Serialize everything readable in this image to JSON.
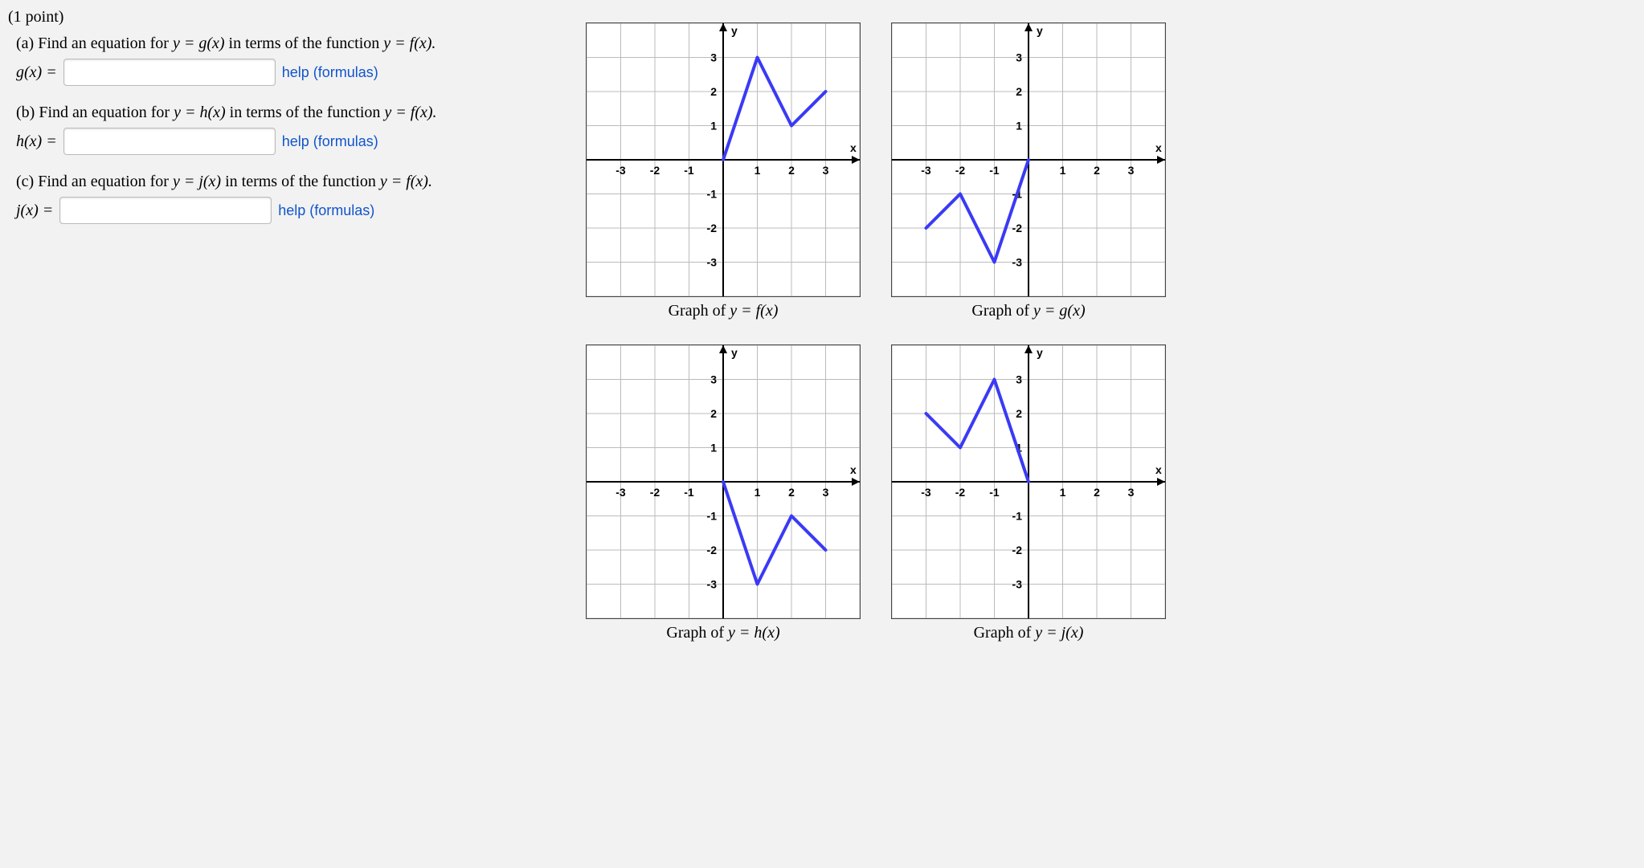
{
  "points_label": "(1 point)",
  "parts": {
    "a": {
      "prompt_prefix": "(a) Find an equation for ",
      "fn_lhs": "y = g(x)",
      "prompt_mid": " in terms of the function ",
      "fn_rhs": "y = f(x).",
      "answer_label": "g(x) =",
      "help_label": "help (formulas)"
    },
    "b": {
      "prompt_prefix": "(b) Find an equation for ",
      "fn_lhs": "y = h(x)",
      "prompt_mid": " in terms of the function ",
      "fn_rhs": "y = f(x).",
      "answer_label": "h(x) =",
      "help_label": "help (formulas)"
    },
    "c": {
      "prompt_prefix": "(c) Find an equation for ",
      "fn_lhs": "y = j(x)",
      "prompt_mid": " in terms of the function ",
      "fn_rhs": "y = f(x).",
      "answer_label": "j(x) =",
      "help_label": "help (formulas)"
    }
  },
  "axis": {
    "xlabel": "x",
    "ylabel": "y",
    "ticks": [
      -3,
      -2,
      -1,
      1,
      2,
      3
    ]
  },
  "chart_data": [
    {
      "type": "line",
      "name": "f",
      "caption_prefix": "Graph of ",
      "caption_fn": "y = f(x)",
      "title": "",
      "xlabel": "x",
      "ylabel": "y",
      "xlim": [
        -4,
        4
      ],
      "ylim": [
        -4,
        4
      ],
      "points": [
        [
          0,
          0
        ],
        [
          1,
          3
        ],
        [
          2,
          1
        ],
        [
          3,
          2
        ]
      ]
    },
    {
      "type": "line",
      "name": "g",
      "caption_prefix": "Graph of ",
      "caption_fn": "y = g(x)",
      "title": "",
      "xlabel": "x",
      "ylabel": "y",
      "xlim": [
        -4,
        4
      ],
      "ylim": [
        -4,
        4
      ],
      "points": [
        [
          -3,
          -2
        ],
        [
          -2,
          -1
        ],
        [
          -1,
          -3
        ],
        [
          0,
          0
        ]
      ]
    },
    {
      "type": "line",
      "name": "h",
      "caption_prefix": "Graph of ",
      "caption_fn": "y = h(x)",
      "title": "",
      "xlabel": "x",
      "ylabel": "y",
      "xlim": [
        -4,
        4
      ],
      "ylim": [
        -4,
        4
      ],
      "points": [
        [
          0,
          0
        ],
        [
          1,
          -3
        ],
        [
          2,
          -1
        ],
        [
          3,
          -2
        ]
      ]
    },
    {
      "type": "line",
      "name": "j",
      "caption_prefix": "Graph of ",
      "caption_fn": "y = j(x)",
      "title": "",
      "xlabel": "x",
      "ylabel": "y",
      "xlim": [
        -4,
        4
      ],
      "ylim": [
        -4,
        4
      ],
      "points": [
        [
          -3,
          2
        ],
        [
          -2,
          1
        ],
        [
          -1,
          3
        ],
        [
          0,
          0
        ]
      ]
    }
  ]
}
